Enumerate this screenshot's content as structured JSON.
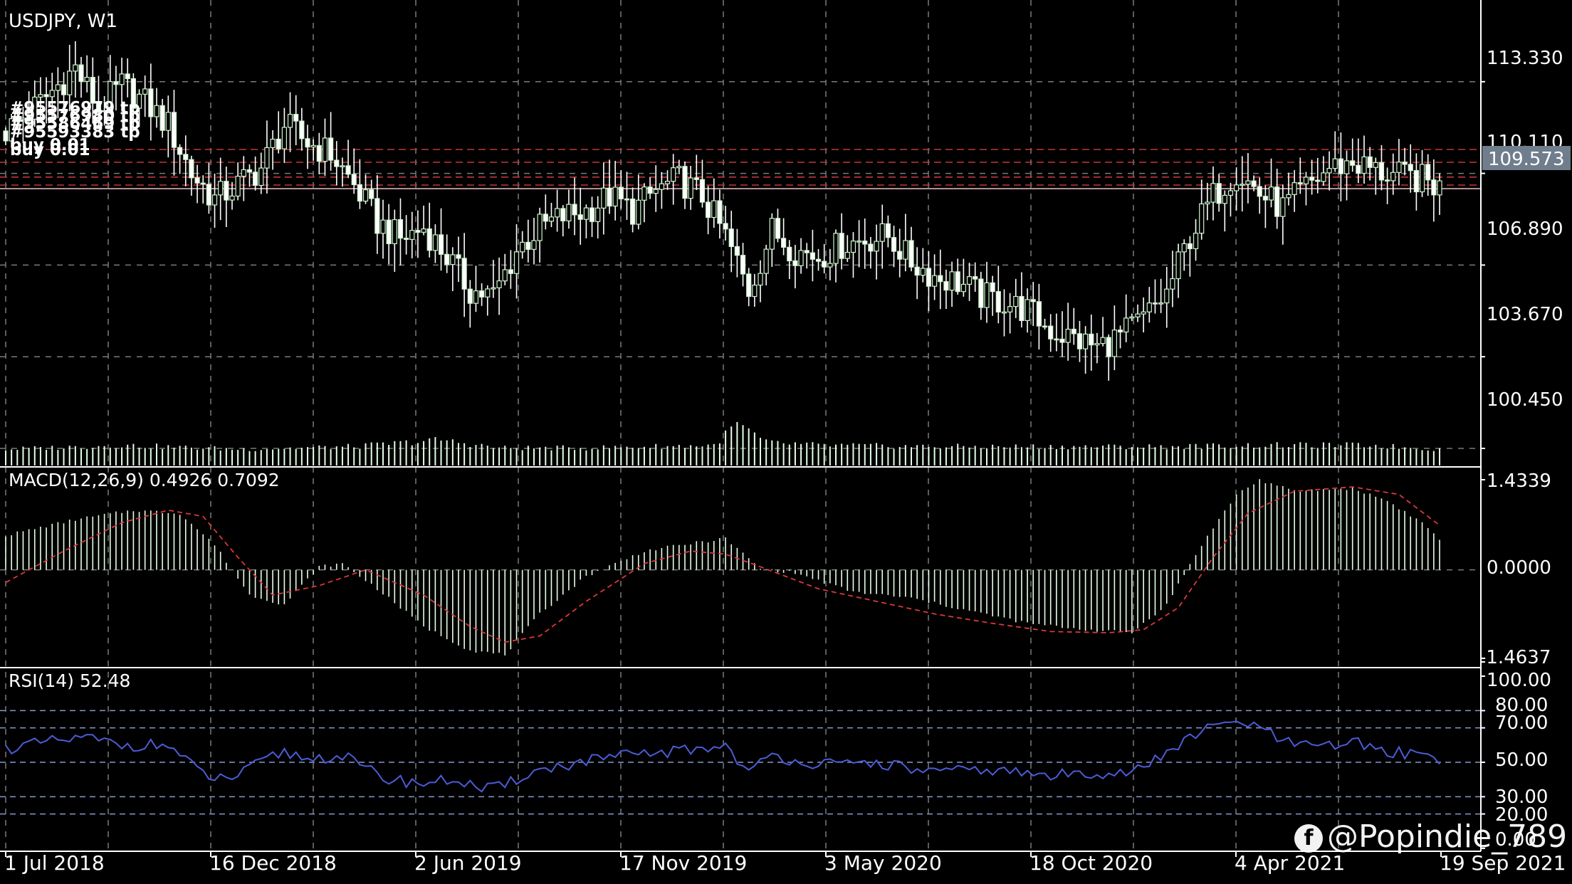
{
  "window": {
    "symbol": "USDJPY",
    "timeframe": "W1",
    "title": "USDJPY, W1"
  },
  "colors": {
    "background": "#000000",
    "grid": "#7a7a7a",
    "candle": "#ffffff",
    "candle_bull": "#ccf5cc",
    "order_line": "#c0393b",
    "current_price_bg": "#6f7d8c",
    "macd_hist": "#e6ffe6",
    "macd_signal": "#d9383a",
    "rsi_line": "#4c5cd6",
    "rsi_levels": "#8899cc",
    "text": "#ffffff"
  },
  "order_labels": [
    "#95576979 tp",
    "#95576980 tp",
    "#95586469 tp",
    "#95593383 tp",
    "buy 0.01",
    "buy 0.01"
  ],
  "current_price": "109.573",
  "macd": {
    "label": "MACD(12,26,9) 0.4926 0.7092",
    "ticks": [
      "1.4339",
      "0.0000",
      "-1.4637"
    ]
  },
  "rsi": {
    "label": "RSI(14) 52.48",
    "ticks": [
      "100.00",
      "80.00",
      "70.00",
      "50.00",
      "30.00",
      "20.00",
      "0.00"
    ]
  },
  "x_labels": [
    "1 Jul 2018",
    "16 Dec 2018",
    "2 Jun 2019",
    "17 Nov 2019",
    "3 May 2020",
    "18 Oct 2020",
    "4 Apr 2021",
    "19 Sep 2021"
  ],
  "watermark": {
    "icon": "f",
    "text": "@Popindie_789"
  },
  "chart_data": [
    {
      "type": "candlestick",
      "title": "USDJPY, W1",
      "y_ticks": [
        "113.330",
        "110.110",
        "106.890",
        "103.670",
        "100.450"
      ],
      "ylim": [
        99.8,
        116.2
      ],
      "grid": true,
      "order_levels": [
        110.95,
        110.5,
        109.98,
        109.7
      ],
      "current_price_level": 109.573,
      "close_path": [
        [
          0,
          111.6
        ],
        [
          6,
          112.6
        ],
        [
          12,
          113.8
        ],
        [
          16,
          112.4
        ],
        [
          20,
          113.2
        ],
        [
          24,
          112.6
        ],
        [
          28,
          111.8
        ],
        [
          32,
          110.1
        ],
        [
          36,
          109.2
        ],
        [
          40,
          109.7
        ],
        [
          44,
          110.3
        ],
        [
          48,
          111.8
        ],
        [
          52,
          111.2
        ],
        [
          56,
          110.8
        ],
        [
          60,
          109.7
        ],
        [
          64,
          108.4
        ],
        [
          68,
          107.8
        ],
        [
          72,
          108.2
        ],
        [
          76,
          107.2
        ],
        [
          80,
          106.0
        ],
        [
          84,
          105.8
        ],
        [
          88,
          107.4
        ],
        [
          92,
          108.2
        ],
        [
          96,
          108.6
        ],
        [
          100,
          108.8
        ],
        [
          104,
          109.3
        ],
        [
          108,
          108.8
        ],
        [
          112,
          109.5
        ],
        [
          116,
          109.9
        ],
        [
          120,
          109.3
        ],
        [
          124,
          107.9
        ],
        [
          128,
          106.0
        ],
        [
          132,
          108.1
        ],
        [
          136,
          107.4
        ],
        [
          140,
          107.2
        ],
        [
          144,
          107.6
        ],
        [
          148,
          107.8
        ],
        [
          152,
          107.9
        ],
        [
          156,
          107.0
        ],
        [
          160,
          106.5
        ],
        [
          164,
          106.3
        ],
        [
          168,
          105.8
        ],
        [
          172,
          105.6
        ],
        [
          176,
          105.3
        ],
        [
          180,
          104.6
        ],
        [
          184,
          104.3
        ],
        [
          188,
          104.0
        ],
        [
          192,
          104.4
        ],
        [
          196,
          105.0
        ],
        [
          200,
          105.9
        ],
        [
          204,
          107.9
        ],
        [
          208,
          109.3
        ],
        [
          212,
          110.2
        ],
        [
          216,
          109.4
        ],
        [
          220,
          108.9
        ],
        [
          224,
          109.6
        ],
        [
          228,
          110.3
        ],
        [
          232,
          110.5
        ],
        [
          236,
          110.2
        ],
        [
          240,
          110.0
        ],
        [
          244,
          109.9
        ],
        [
          247,
          109.6
        ]
      ],
      "volume_path": [
        [
          0,
          0.24
        ],
        [
          20,
          0.3
        ],
        [
          40,
          0.24
        ],
        [
          60,
          0.28
        ],
        [
          75,
          0.38
        ],
        [
          85,
          0.26
        ],
        [
          100,
          0.26
        ],
        [
          122,
          0.3
        ],
        [
          126,
          0.62
        ],
        [
          131,
          0.34
        ],
        [
          140,
          0.3
        ],
        [
          160,
          0.28
        ],
        [
          180,
          0.28
        ],
        [
          200,
          0.28
        ],
        [
          215,
          0.3
        ],
        [
          235,
          0.3
        ],
        [
          247,
          0.24
        ]
      ]
    },
    {
      "type": "bar",
      "title": "MACD(12,26,9) 0.4926 0.7092",
      "ylim": [
        -1.4637,
        1.4339
      ],
      "series": [
        {
          "name": "MACD",
          "path": [
            [
              0,
              0.55
            ],
            [
              12,
              0.8
            ],
            [
              22,
              0.95
            ],
            [
              30,
              0.9
            ],
            [
              36,
              0.4
            ],
            [
              42,
              -0.4
            ],
            [
              48,
              -0.55
            ],
            [
              54,
              0.05
            ],
            [
              58,
              0.1
            ],
            [
              64,
              -0.3
            ],
            [
              72,
              -0.9
            ],
            [
              80,
              -1.28
            ],
            [
              86,
              -1.35
            ],
            [
              92,
              -0.7
            ],
            [
              100,
              -0.1
            ],
            [
              110,
              0.3
            ],
            [
              118,
              0.42
            ],
            [
              124,
              0.5
            ],
            [
              130,
              0.02
            ],
            [
              136,
              -0.05
            ],
            [
              146,
              -0.35
            ],
            [
              156,
              -0.45
            ],
            [
              166,
              -0.65
            ],
            [
              176,
              -0.85
            ],
            [
              186,
              -0.95
            ],
            [
              194,
              -1.0
            ],
            [
              200,
              -0.55
            ],
            [
              206,
              0.4
            ],
            [
              212,
              1.2
            ],
            [
              216,
              1.43
            ],
            [
              222,
              1.25
            ],
            [
              232,
              1.3
            ],
            [
              238,
              1.1
            ],
            [
              244,
              0.75
            ],
            [
              247,
              0.49
            ]
          ]
        },
        {
          "name": "Signal",
          "path": [
            [
              0,
              -0.2
            ],
            [
              10,
              0.3
            ],
            [
              20,
              0.75
            ],
            [
              28,
              0.95
            ],
            [
              34,
              0.85
            ],
            [
              40,
              0.2
            ],
            [
              46,
              -0.4
            ],
            [
              54,
              -0.25
            ],
            [
              62,
              0.0
            ],
            [
              72,
              -0.4
            ],
            [
              80,
              -0.9
            ],
            [
              86,
              -1.15
            ],
            [
              92,
              -1.05
            ],
            [
              100,
              -0.5
            ],
            [
              110,
              0.1
            ],
            [
              118,
              0.3
            ],
            [
              124,
              0.25
            ],
            [
              130,
              0.05
            ],
            [
              140,
              -0.3
            ],
            [
              150,
              -0.5
            ],
            [
              160,
              -0.7
            ],
            [
              170,
              -0.85
            ],
            [
              180,
              -0.98
            ],
            [
              190,
              -1.0
            ],
            [
              196,
              -0.95
            ],
            [
              202,
              -0.6
            ],
            [
              208,
              0.2
            ],
            [
              214,
              0.9
            ],
            [
              222,
              1.25
            ],
            [
              232,
              1.32
            ],
            [
              240,
              1.2
            ],
            [
              247,
              0.71
            ]
          ]
        }
      ]
    },
    {
      "type": "line",
      "title": "RSI(14) 52.48",
      "ylim": [
        0,
        100
      ],
      "levels": [
        80,
        70,
        50,
        30,
        20
      ],
      "series": [
        {
          "name": "RSI(14)",
          "path": [
            [
              0,
              58
            ],
            [
              8,
              62
            ],
            [
              14,
              64
            ],
            [
              20,
              60
            ],
            [
              28,
              60
            ],
            [
              32,
              48
            ],
            [
              36,
              40
            ],
            [
              40,
              42
            ],
            [
              44,
              50
            ],
            [
              48,
              56
            ],
            [
              52,
              52
            ],
            [
              58,
              54
            ],
            [
              62,
              46
            ],
            [
              66,
              40
            ],
            [
              72,
              38
            ],
            [
              78,
              40
            ],
            [
              82,
              34
            ],
            [
              86,
              36
            ],
            [
              90,
              44
            ],
            [
              96,
              48
            ],
            [
              102,
              52
            ],
            [
              108,
              54
            ],
            [
              114,
              56
            ],
            [
              120,
              58
            ],
            [
              124,
              60
            ],
            [
              128,
              44
            ],
            [
              132,
              54
            ],
            [
              138,
              50
            ],
            [
              144,
              48
            ],
            [
              150,
              50
            ],
            [
              156,
              46
            ],
            [
              162,
              44
            ],
            [
              168,
              46
            ],
            [
              174,
              44
            ],
            [
              180,
              42
            ],
            [
              186,
              44
            ],
            [
              192,
              44
            ],
            [
              196,
              46
            ],
            [
              200,
              56
            ],
            [
              206,
              68
            ],
            [
              212,
              74
            ],
            [
              216,
              70
            ],
            [
              220,
              62
            ],
            [
              226,
              58
            ],
            [
              232,
              62
            ],
            [
              238,
              56
            ],
            [
              244,
              55
            ],
            [
              247,
              52
            ]
          ]
        }
      ]
    }
  ]
}
